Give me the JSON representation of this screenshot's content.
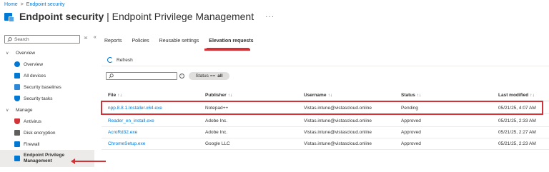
{
  "breadcrumb": {
    "home": "Home",
    "sep": ">",
    "current": "Endpoint security"
  },
  "header": {
    "title_bold": "Endpoint security",
    "title_rest": " | Endpoint Privilege Management",
    "more": "···"
  },
  "sidebar": {
    "search_placeholder": "Search",
    "tools": {
      "expand": "⟠",
      "collapse": "«"
    },
    "items": [
      {
        "label": "Overview",
        "type": "group",
        "chevron": "∨"
      },
      {
        "label": "Overview",
        "icon": "info-icon",
        "color": "#0078d4"
      },
      {
        "label": "All devices",
        "icon": "devices-icon",
        "color": "#0078d4"
      },
      {
        "label": "Security baselines",
        "icon": "baselines-icon",
        "color": "#0078d4"
      },
      {
        "label": "Security tasks",
        "icon": "shield-icon",
        "color": "#0078d4"
      },
      {
        "label": "Manage",
        "type": "group",
        "chevron": "∨"
      },
      {
        "label": "Antivirus",
        "icon": "antivirus-icon",
        "color": "#d13438"
      },
      {
        "label": "Disk encryption",
        "icon": "disk-icon",
        "color": "#605e5c"
      },
      {
        "label": "Firewall",
        "icon": "firewall-icon",
        "color": "#0078d4"
      },
      {
        "label": "Endpoint Privilege Management",
        "icon": "epm-icon",
        "color": "#0078d4",
        "active": true
      }
    ]
  },
  "tabs": [
    "Reports",
    "Policies",
    "Reusable settings",
    "Elevation requests"
  ],
  "active_tab": "Elevation requests",
  "toolbar": {
    "refresh": "Refresh"
  },
  "filter": {
    "search_placeholder": "",
    "info": "i",
    "status_label": "Status ==",
    "status_value": "all"
  },
  "table": {
    "columns": [
      "File",
      "Publisher",
      "Username",
      "Status",
      "Last modified"
    ],
    "sort_glyph": "↑↓",
    "rows": [
      {
        "file": "npp.8.8.1.Installer.x64.exe",
        "publisher": "Notepad++",
        "username": "Vistas.intune@vistascloud.online",
        "status": "Pending",
        "modified": "05/21/25, 4:07 AM"
      },
      {
        "file": "Reader_en_install.exe",
        "publisher": "Adobe Inc.",
        "username": "Vistas.intune@vistascloud.online",
        "status": "Approved",
        "modified": "05/21/25, 2:33 AM"
      },
      {
        "file": "AcroRd32.exe",
        "publisher": "Adobe Inc.",
        "username": "Vistas.intune@vistascloud.online",
        "status": "Approved",
        "modified": "05/21/25, 2:27 AM"
      },
      {
        "file": "ChromeSetup.exe",
        "publisher": "Google LLC",
        "username": "Vistas.intune@vistascloud.online",
        "status": "Approved",
        "modified": "05/21/25, 2:23 AM"
      }
    ]
  },
  "colors": {
    "accent": "#0078d4",
    "annotation": "#d13438"
  }
}
